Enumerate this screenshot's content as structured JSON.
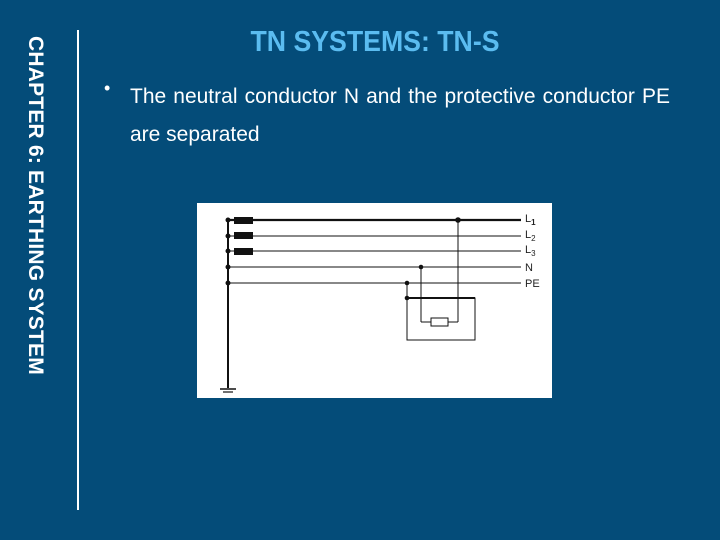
{
  "sidebar": {
    "chapter_title": "CHAPTER 6: EARTHING SYSTEM"
  },
  "slide": {
    "title": "TN SYSTEMS: TN-S",
    "bullets": [
      {
        "marker": "•",
        "text": "The neutral conductor N and the protective conductor PE are separated"
      }
    ]
  },
  "diagram": {
    "description": "TN-S system wiring diagram",
    "conductors": [
      {
        "name": "L",
        "subscript": "1"
      },
      {
        "name": "L",
        "subscript": "2"
      },
      {
        "name": "L",
        "subscript": "3"
      },
      {
        "name": "N",
        "subscript": ""
      },
      {
        "name": "PE",
        "subscript": ""
      }
    ]
  }
}
